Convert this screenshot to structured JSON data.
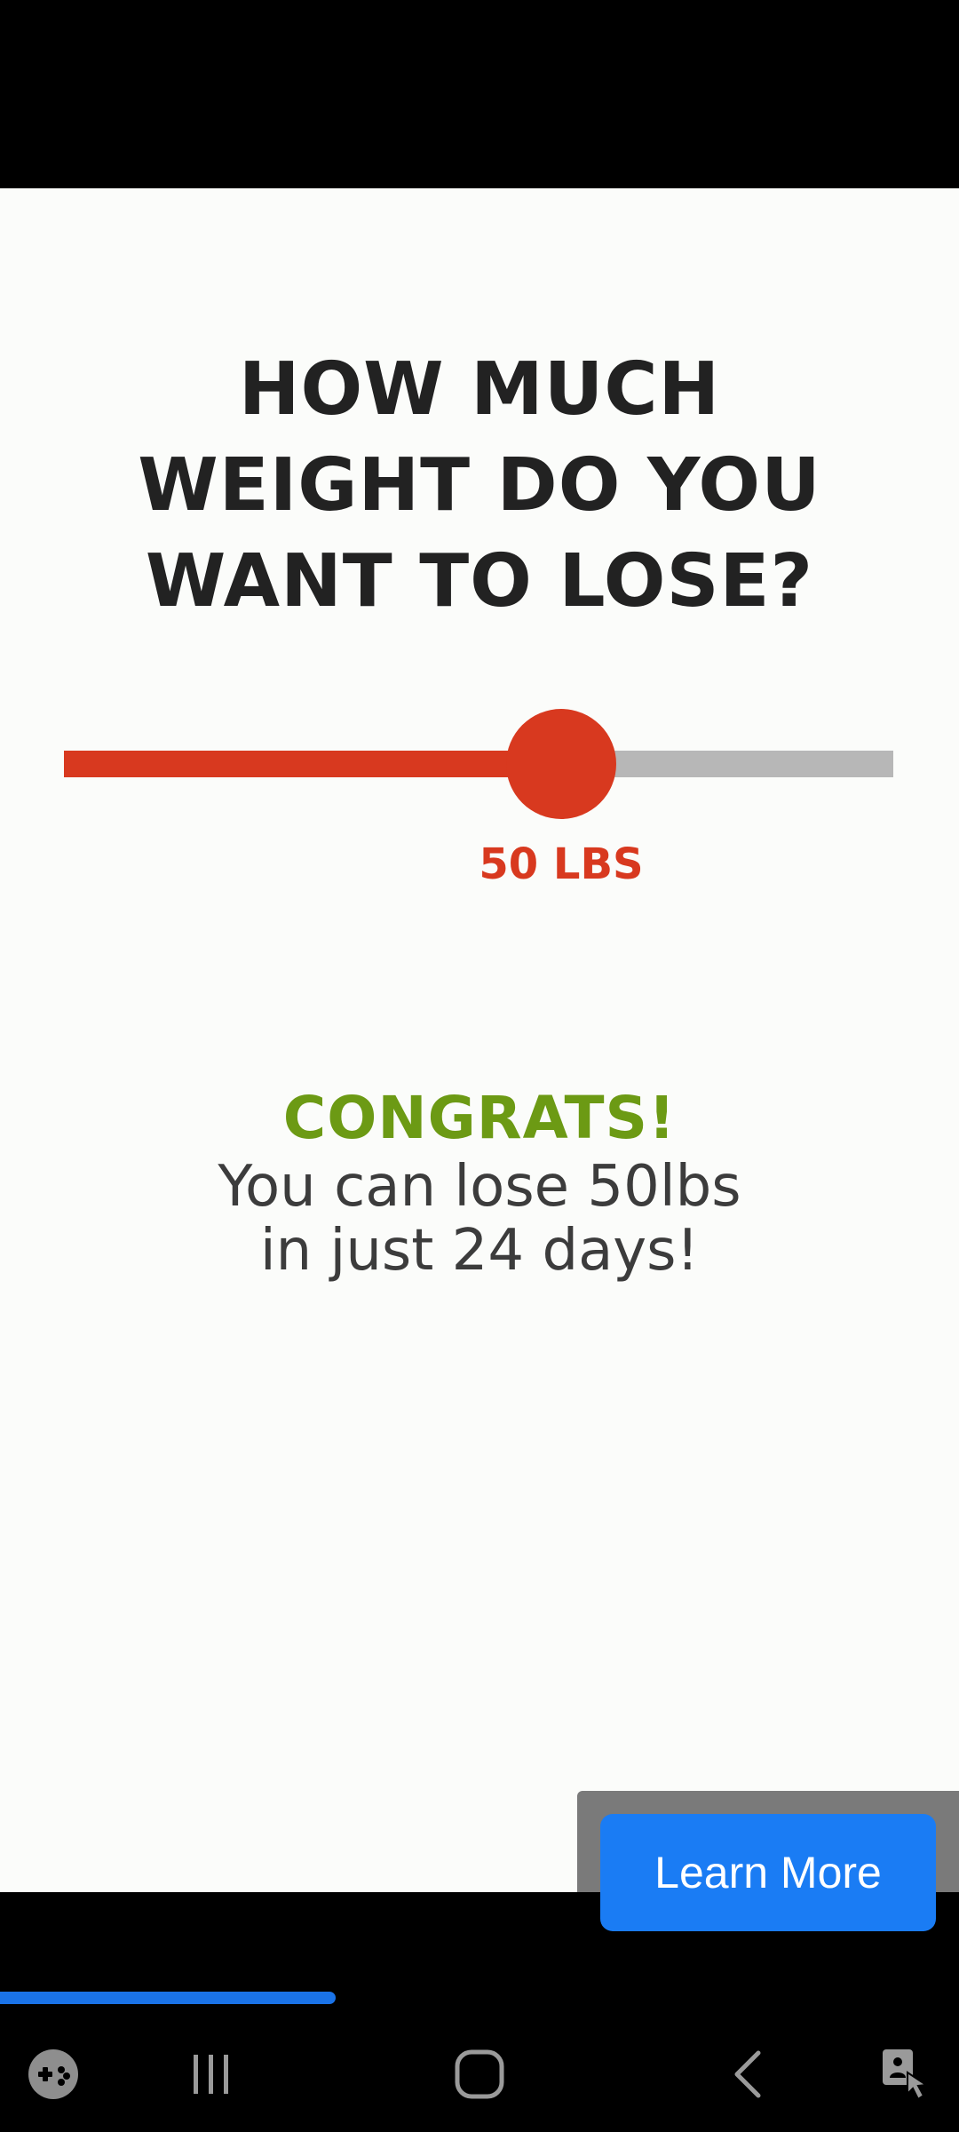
{
  "ad": {
    "question_lines": [
      "HOW MUCH",
      "WEIGHT DO YOU",
      "WANT TO LOSE?"
    ],
    "slider": {
      "fraction": 0.6,
      "value_label": "50 LBS"
    },
    "congrats": "CONGRATS!",
    "result_lines": [
      "You can lose 50lbs",
      "in just 24 days!"
    ],
    "cta_label": "Learn More"
  },
  "video_progress": 0.35,
  "nav": {
    "game_tools_icon": "game-controller-icon",
    "recents_icon": "recents-icon",
    "home_icon": "home-icon",
    "back_icon": "back-icon",
    "accessibility_icon": "touch-accessibility-icon"
  },
  "colors": {
    "accent_red": "#d8391f",
    "congrats_green": "#6c9a14",
    "cta_blue": "#1a7cf4",
    "progress_blue": "#1a73e8"
  }
}
